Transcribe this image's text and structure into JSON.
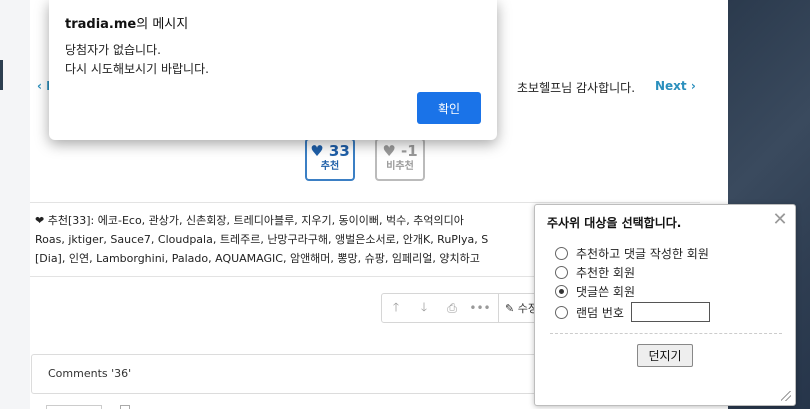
{
  "nav": {
    "prev": "‹ I",
    "thanks": "초보헬프님 감사합니다.",
    "next": "Next ›"
  },
  "votes": {
    "up": {
      "count": "33",
      "label": "추천"
    },
    "down": {
      "count": "-1",
      "label": "비추천"
    }
  },
  "recommend": {
    "lines": [
      "❤ 추천[33]: 에코-Eco, 관상가, 신촌회장, 트레디아블루, 지우기, 동이이뻐, 벅수, 추억의디아",
      "Roas, jktiger, Sauce7, Cloudpala, 트레주르, 난망구라구해, 앵벌은소서로, 안개K, RuPlya, S",
      "[Dia], 인연, Lamborghini, Palado, AQUAMAGIC, 암앤해머, 뽕망, 슈팡, 임페리얼, 양치하고"
    ]
  },
  "toolbar": {
    "edit_label": "수정"
  },
  "comments": {
    "label": "Comments '36'"
  },
  "alert": {
    "title_site": "tradia.me",
    "title_suffix": "의 메시지",
    "message_line1": "당첨자가 없습니다.",
    "message_line2": "다시 시도해보시기 바랍니다.",
    "ok_label": "확인"
  },
  "dice": {
    "title": "주사위 대상을 선택합니다.",
    "close": "✕",
    "options": [
      {
        "label": "추천하고 댓글 작성한 회원",
        "selected": false
      },
      {
        "label": "추천한 회원",
        "selected": false
      },
      {
        "label": "댓글쓴 회원",
        "selected": true
      },
      {
        "label": "랜덤 번호",
        "selected": false
      }
    ],
    "random_value": "",
    "throw_label": "던지기"
  }
}
